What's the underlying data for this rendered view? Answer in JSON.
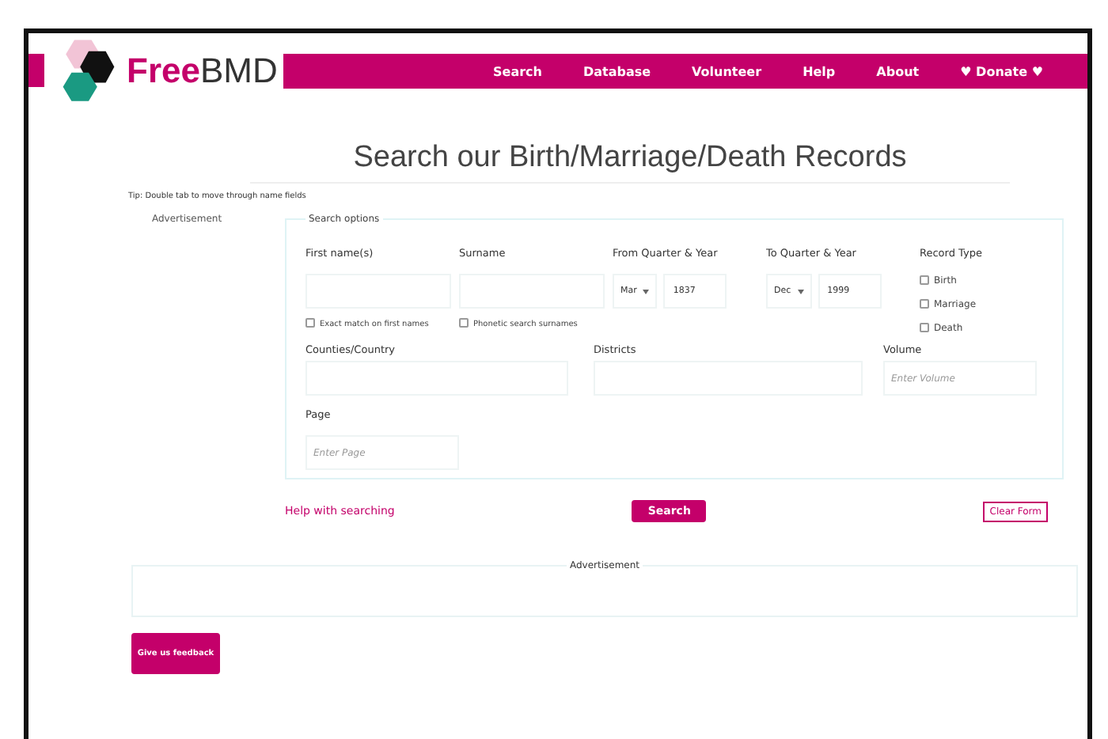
{
  "header": {
    "logo": {
      "part_1": "Free",
      "part_2": "BMD"
    },
    "nav": [
      "Search",
      "Database",
      "Volunteer",
      "Help",
      "About",
      "♥ Donate ♥"
    ]
  },
  "title": "Search our Birth/Marriage/Death Records",
  "tip": "Tip: Double tab to move through name fields",
  "side_ad": "Advertisement",
  "search_options": {
    "legend": "Search options",
    "first_name": {
      "label": "First name(s)",
      "option": {
        "label": "Exact match on first names",
        "checked": false
      }
    },
    "surname": {
      "label": "Surname",
      "option": {
        "label": "Phonetic search surnames",
        "checked": false
      }
    },
    "from": {
      "label": "From Quarter & Year",
      "quarter": "Mar",
      "year": "1837"
    },
    "to": {
      "label": "To Quarter & Year",
      "quarter": "Dec",
      "year": "1999"
    },
    "record_type": {
      "label": "Record Type",
      "options": [
        {
          "label": "Birth",
          "checked": false
        },
        {
          "label": "Marriage",
          "checked": false
        },
        {
          "label": "Death",
          "checked": false
        }
      ]
    },
    "counties": {
      "label": "Counties/Country"
    },
    "districts": {
      "label": "Districts"
    },
    "volume": {
      "label": "Volume",
      "placeholder": "Enter Volume"
    },
    "page": {
      "label": "Page",
      "placeholder": "Enter Page"
    }
  },
  "help_link": "Help with searching",
  "search_button": "Search",
  "clear_button": "Clear Form",
  "bottom_ad": "Advertisement",
  "feedback_button": "Give us feedback"
}
